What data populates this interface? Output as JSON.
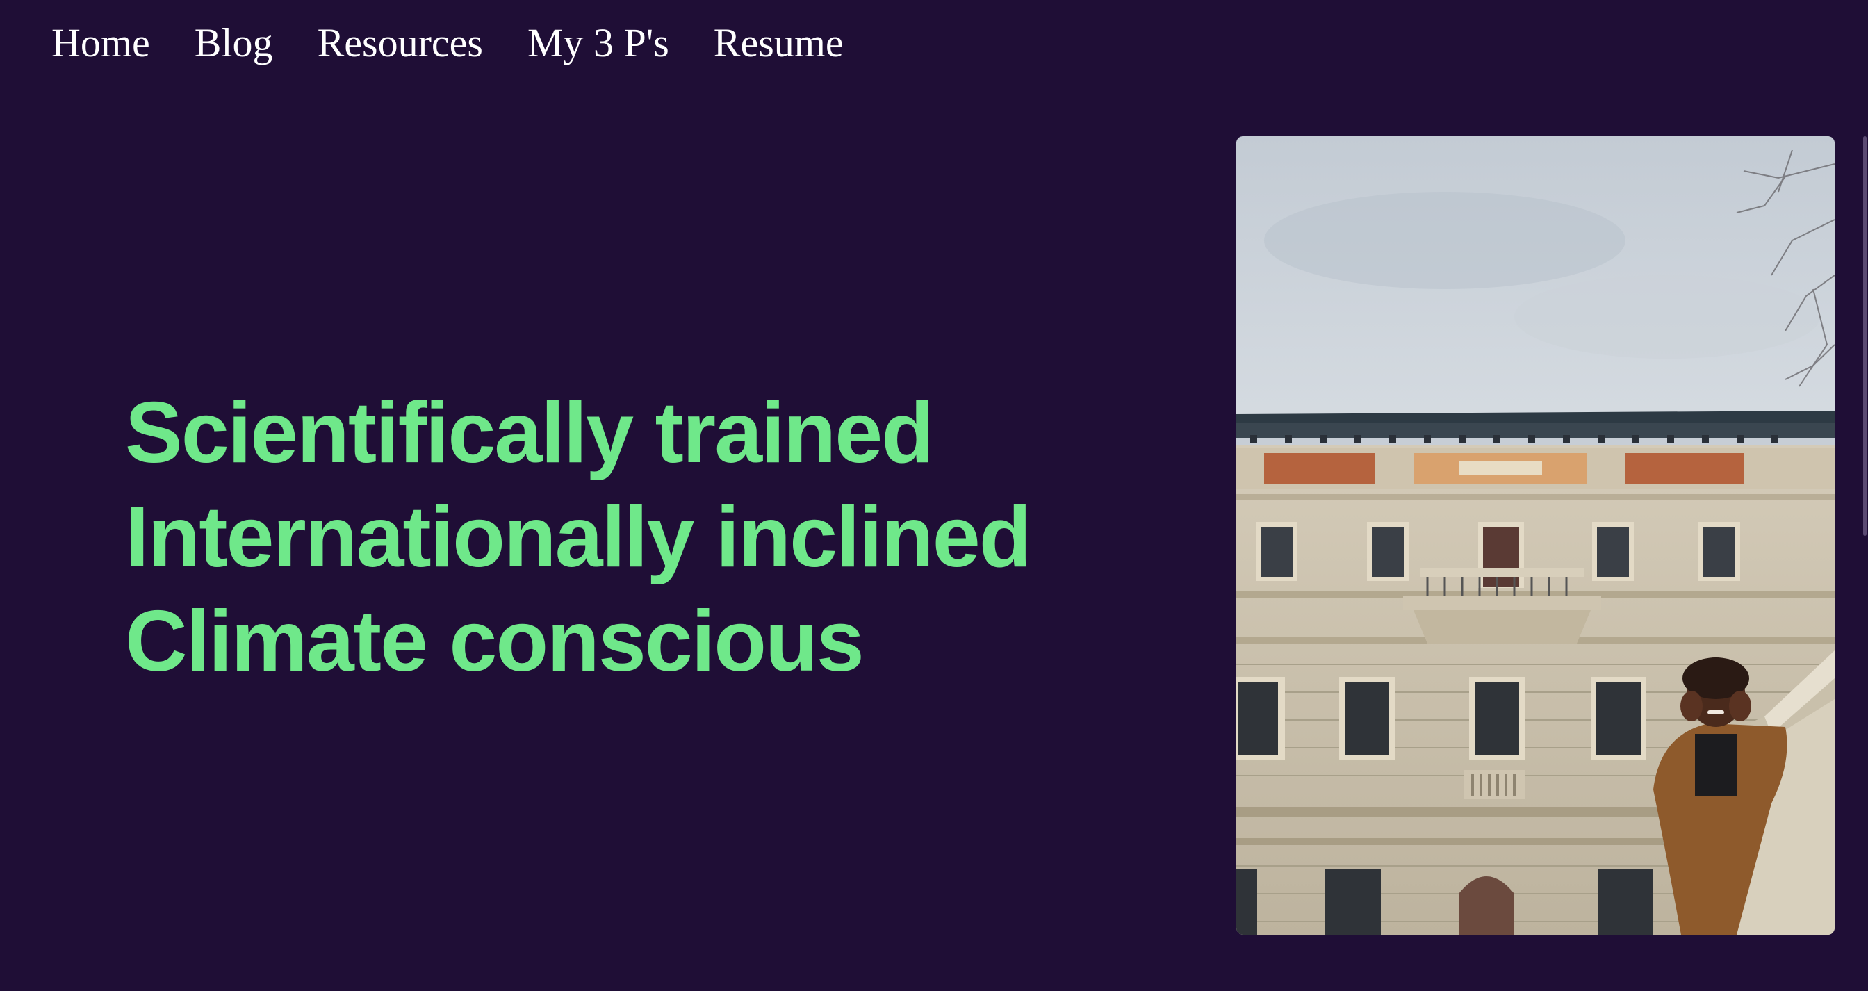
{
  "nav": {
    "items": [
      {
        "label": "Home"
      },
      {
        "label": "Blog"
      },
      {
        "label": "Resources"
      },
      {
        "label": "My 3 P's"
      },
      {
        "label": "Resume"
      }
    ]
  },
  "hero": {
    "lines": [
      "Scientifically trained",
      "Internationally inclined",
      "Climate conscious"
    ]
  },
  "colors": {
    "background": "#1f0e36",
    "accent": "#6fe88a",
    "nav_text": "#ffffff"
  }
}
